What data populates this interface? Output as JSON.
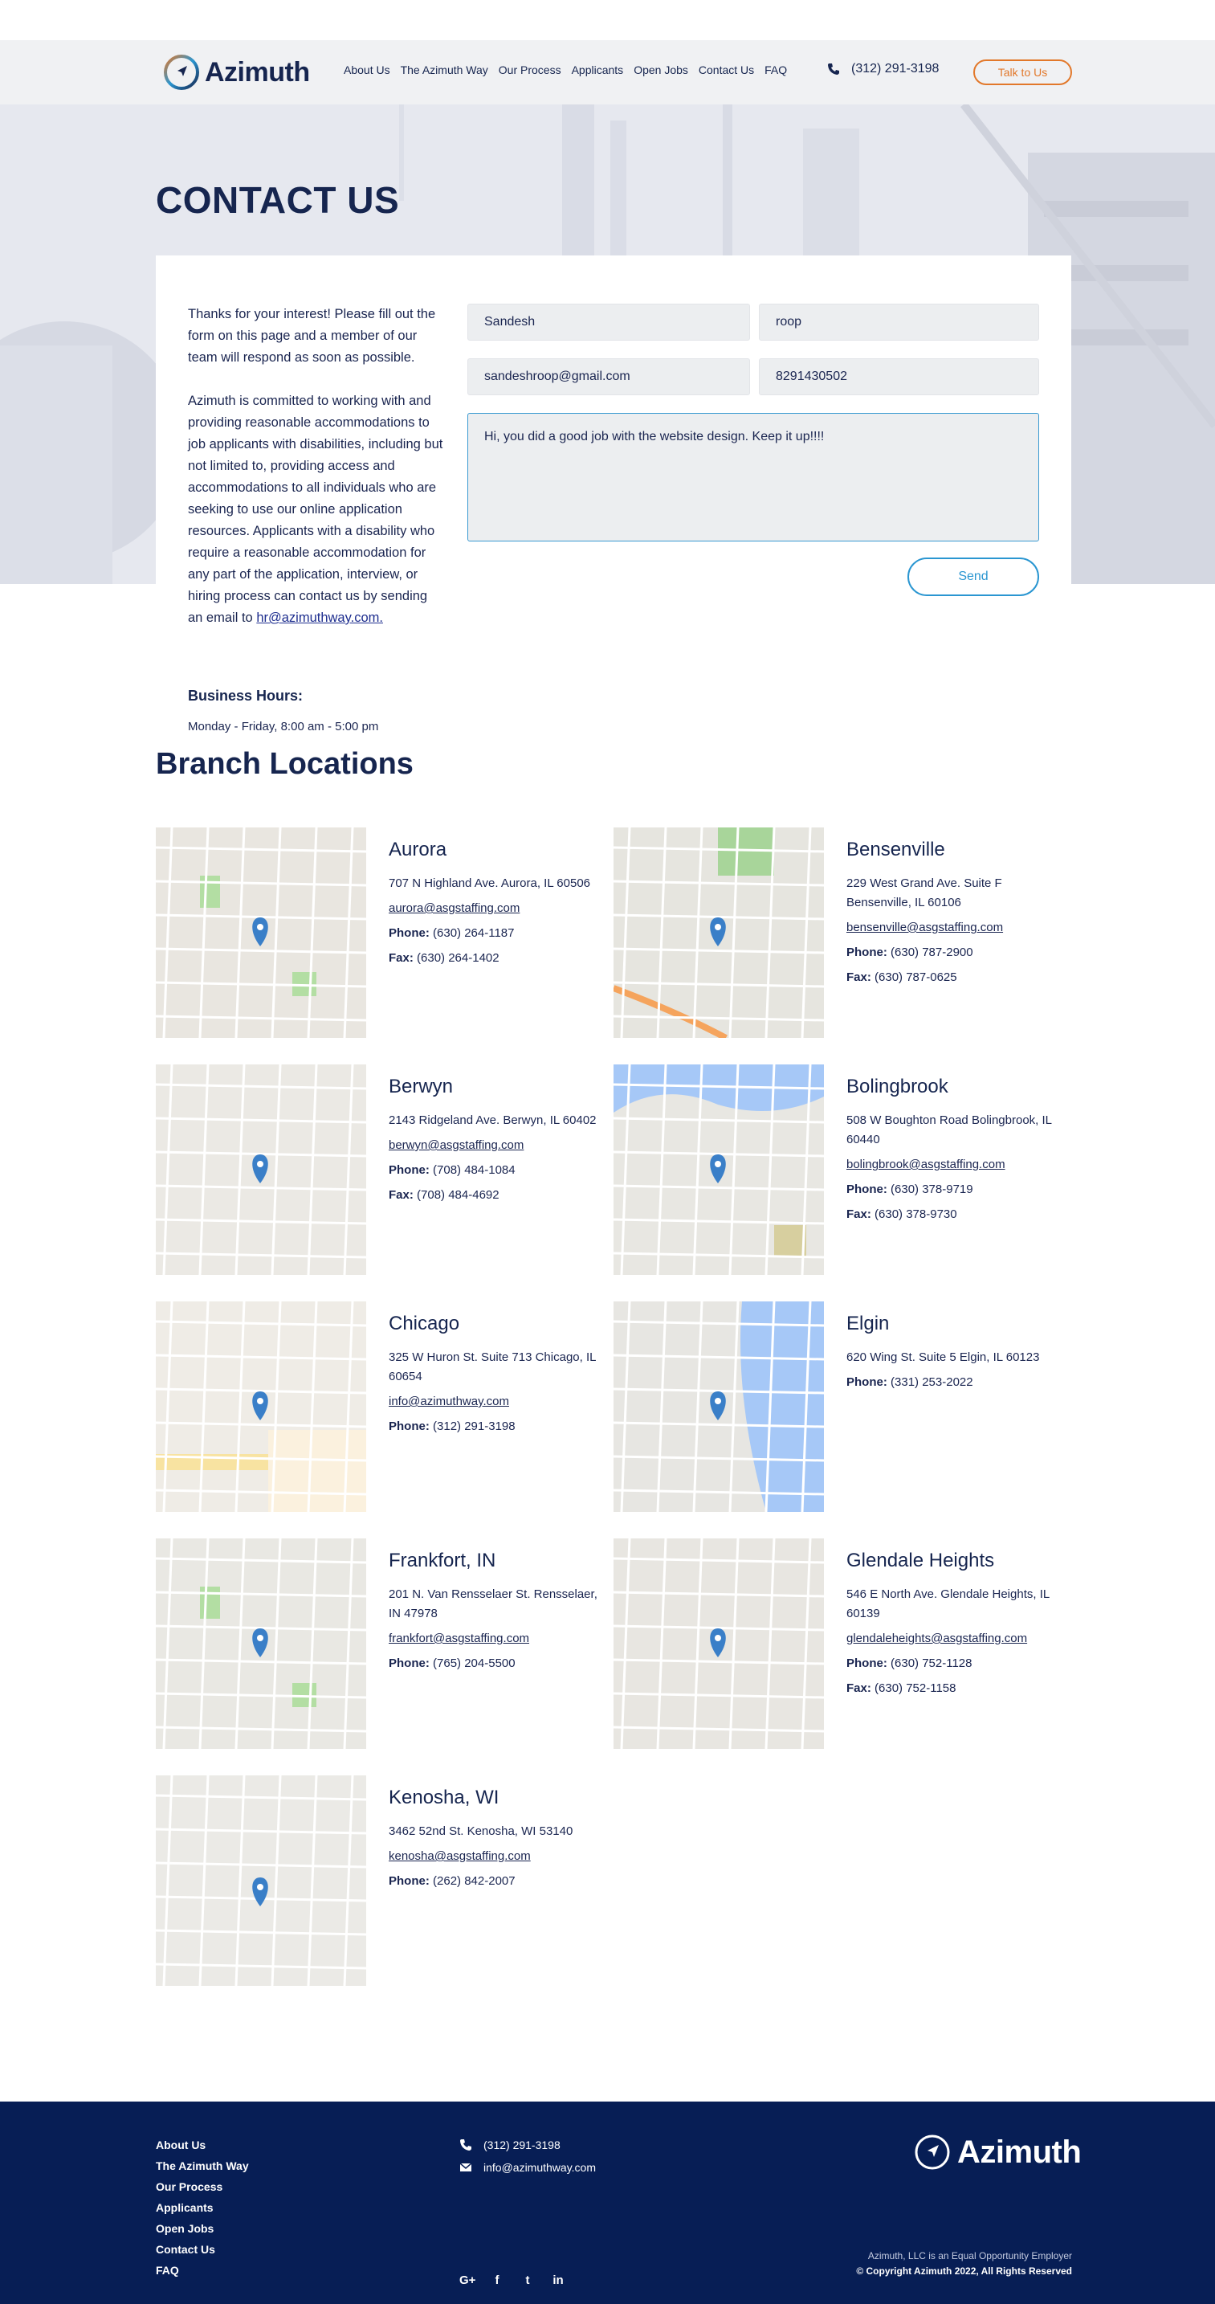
{
  "header": {
    "logo_text": "Azimuth",
    "nav": [
      "About Us",
      "The Azimuth Way",
      "Our Process",
      "Applicants",
      "Open Jobs",
      "Contact Us",
      "FAQ"
    ],
    "phone": "(312) 291-3198",
    "cta_label": "Talk to Us"
  },
  "hero": {
    "title": "CONTACT US"
  },
  "contact": {
    "intro_1": "Thanks for your interest! Please fill out the form on this page and a member of our team will respond as soon as possible.",
    "intro_2": "Azimuth is committed to working with and providing reasonable accommodations to job applicants with disabilities, including but not limited to, providing access and accommodations to all individuals who are seeking to use our online application resources. Applicants with a disability who require a reasonable accommodation for any part of the application, interview, or hiring process can contact us by sending an email to",
    "email_link": "hr@azimuthway.com.",
    "hours_title": "Business Hours:",
    "hours_text": "Monday - Friday, 8:00 am - 5:00 pm",
    "form": {
      "first_name": "Sandesh",
      "last_name": "roop",
      "email": "sandeshroop@gmail.com",
      "phone": "8291430502",
      "message": "Hi, you did a good job with the website design. Keep it up!!!!"
    },
    "send_label": "Send"
  },
  "branches": {
    "title": "Branch Locations",
    "phone_label": "Phone:",
    "fax_label": "Fax:",
    "items": [
      {
        "name": "Aurora",
        "address": "707 N Highland Ave. Aurora, IL 60506",
        "email": "aurora@asgstaffing.com",
        "phone": "(630) 264-1187",
        "fax": "(630) 264-1402"
      },
      {
        "name": "Bensenville",
        "address": "229 West Grand Ave. Suite F Bensenville, IL 60106",
        "email": "bensenville@asgstaffing.com",
        "phone": "(630) 787-2900",
        "fax": "(630) 787-0625"
      },
      {
        "name": "Berwyn",
        "address": "2143 Ridgeland Ave. Berwyn, IL 60402",
        "email": "berwyn@asgstaffing.com",
        "phone": "(708) 484-1084",
        "fax": "(708) 484-4692"
      },
      {
        "name": "Bolingbrook",
        "address": "508 W Boughton Road Bolingbrook, IL 60440",
        "email": "bolingbrook@asgstaffing.com",
        "phone": "(630) 378-9719",
        "fax": "(630) 378-9730"
      },
      {
        "name": "Chicago",
        "address": "325 W Huron St. Suite 713 Chicago, IL 60654",
        "email": "info@azimuthway.com",
        "phone": "(312) 291-3198",
        "fax": null
      },
      {
        "name": "Elgin",
        "address": "620 Wing St. Suite 5 Elgin, IL 60123",
        "email": null,
        "phone": "(331) 253-2022",
        "fax": null
      },
      {
        "name": "Frankfort, IN",
        "address": "201 N. Van Rensselaer St. Rensselaer, IN 47978",
        "email": "frankfort@asgstaffing.com",
        "phone": "(765) 204-5500",
        "fax": null
      },
      {
        "name": "Glendale Heights",
        "address": "546 E North Ave. Glendale Heights, IL 60139",
        "email": "glendaleheights@asgstaffing.com",
        "phone": "(630) 752-1128",
        "fax": "(630) 752-1158"
      },
      {
        "name": "Kenosha, WI",
        "address": "3462 52nd St. Kenosha, WI 53140",
        "email": "kenosha@asgstaffing.com",
        "phone": "(262) 842-2007",
        "fax": null
      }
    ]
  },
  "footer": {
    "links": [
      "About Us",
      "The Azimuth Way",
      "Our Process",
      "Applicants",
      "Open Jobs",
      "Contact Us",
      "FAQ"
    ],
    "phone": "(312) 291-3198",
    "email": "info@azimuthway.com",
    "logo_text": "Azimuth",
    "eeo": "Azimuth, LLC is an Equal Opportunity Employer",
    "copyright": "© Copyright Azimuth 2022, All Rights Reserved",
    "social_icons": [
      "google-plus-icon",
      "facebook-icon",
      "twitter-icon",
      "linkedin-icon"
    ],
    "social_glyphs": [
      "G+",
      "f",
      "t",
      "in"
    ]
  },
  "colors": {
    "navy": "#16254f",
    "orange": "#e2782a",
    "blue": "#2a96d1",
    "footer_bg": "#071e55"
  }
}
